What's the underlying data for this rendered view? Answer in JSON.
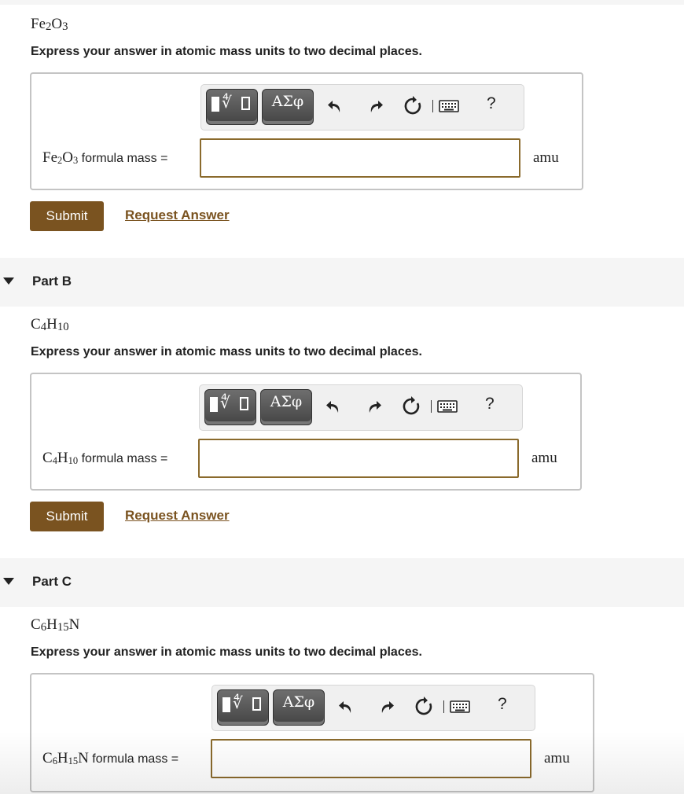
{
  "parts": [
    {
      "header": "",
      "formula": {
        "sym": [
          "Fe",
          "O"
        ],
        "sub": [
          "2",
          "3"
        ]
      },
      "instruction": "Express your answer in atomic mass units to two decimal places.",
      "field_label_suffix": " formula mass =",
      "input_value": "",
      "unit": "amu",
      "submit_label": "Submit",
      "request_label": "Request Answer"
    },
    {
      "header": "Part B",
      "formula": {
        "sym": [
          "C",
          "H"
        ],
        "sub": [
          "4",
          "10"
        ]
      },
      "instruction": "Express your answer in atomic mass units to two decimal places.",
      "field_label_suffix": " formula mass =",
      "input_value": "",
      "unit": "amu",
      "submit_label": "Submit",
      "request_label": "Request Answer"
    },
    {
      "header": "Part C",
      "formula": {
        "sym": [
          "C",
          "H",
          "N"
        ],
        "sub": [
          "6",
          "15",
          ""
        ]
      },
      "instruction": "Express your answer in atomic mass units to two decimal places.",
      "field_label_suffix": " formula mass =",
      "input_value": "",
      "unit": "amu"
    }
  ],
  "toolbar": {
    "greek_label": "ΑΣφ",
    "help_label": "?",
    "icons": [
      "templates-icon",
      "greek-symbols-icon",
      "undo-icon",
      "redo-icon",
      "reset-icon",
      "keyboard-icon",
      "help-icon"
    ]
  }
}
